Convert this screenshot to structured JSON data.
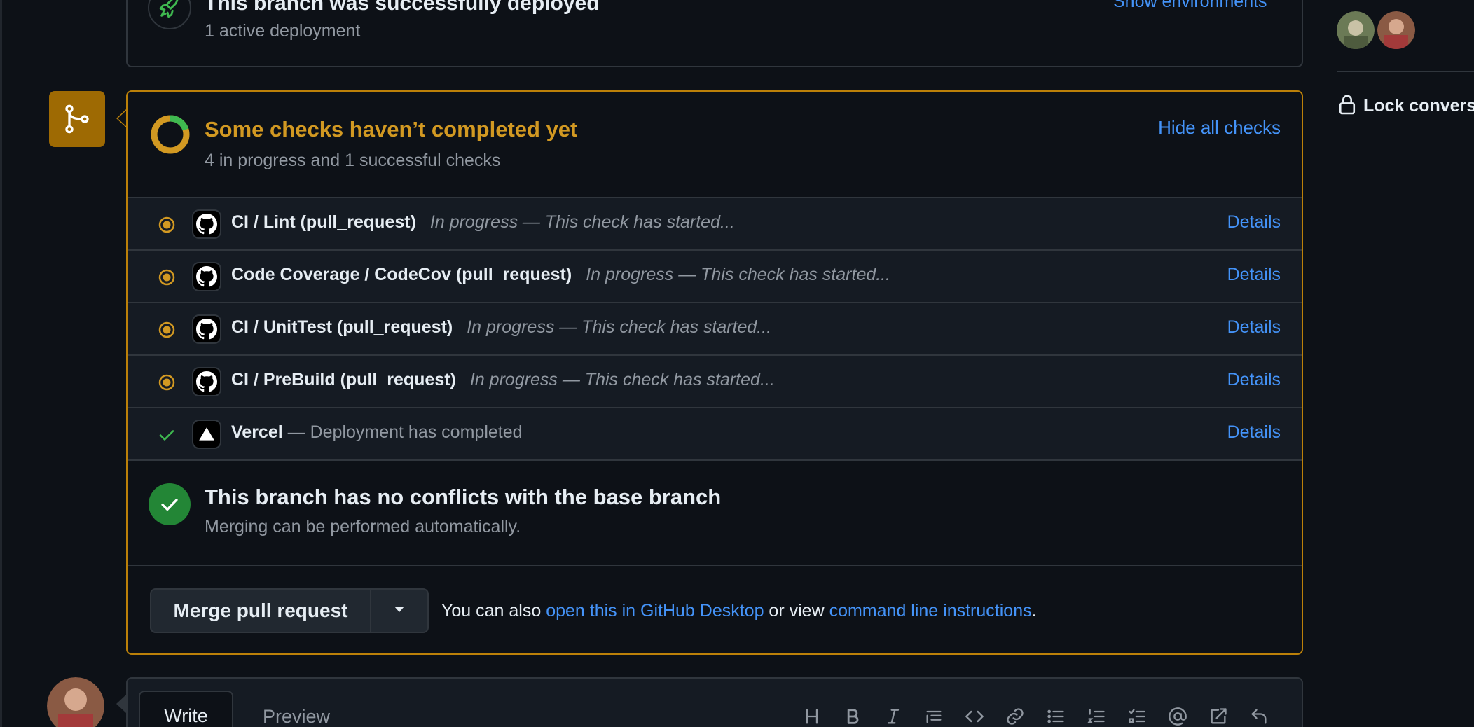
{
  "deployment": {
    "title": "This branch was successfully deployed",
    "subtitle": "1 active deployment",
    "action": "Show environments",
    "icon": "rocket-icon"
  },
  "sidebar": {
    "participants": [
      "avatar-1",
      "avatar-2"
    ],
    "lock_label": "Lock conversa"
  },
  "checks": {
    "title": "Some checks haven’t completed yet",
    "subtitle": "4 in progress and 1 successful checks",
    "toggle": "Hide all checks",
    "progress": {
      "in_progress": 4,
      "successful": 1
    },
    "items": [
      {
        "name": "CI / Lint (pull_request)",
        "description": "In progress — This check has started...",
        "status": "in_progress",
        "app_icon": "github-icon",
        "action": "Details"
      },
      {
        "name": "Code Coverage / CodeCov (pull_request)",
        "description": "In progress — This check has started...",
        "status": "in_progress",
        "app_icon": "github-icon",
        "action": "Details"
      },
      {
        "name": "CI / UnitTest (pull_request)",
        "description": "In progress — This check has started...",
        "status": "in_progress",
        "app_icon": "github-icon",
        "action": "Details"
      },
      {
        "name": "CI / PreBuild (pull_request)",
        "description": "In progress — This check has started...",
        "status": "in_progress",
        "app_icon": "github-icon",
        "action": "Details"
      },
      {
        "name": "Vercel",
        "description": "— Deployment has completed",
        "status": "success",
        "app_icon": "vercel-icon",
        "action": "Details"
      }
    ]
  },
  "conflicts": {
    "title": "This branch has no conflicts with the base branch",
    "subtitle": "Merging can be performed automatically."
  },
  "merge": {
    "button_label": "Merge pull request",
    "note_prefix": "You can also ",
    "link_desktop": "open this in GitHub Desktop",
    "note_middle": " or view ",
    "link_cli": "command line instructions",
    "note_suffix": "."
  },
  "comment": {
    "tab_write": "Write",
    "tab_preview": "Preview",
    "toolbar": [
      "heading-icon",
      "bold-icon",
      "italic-icon",
      "quote-icon",
      "code-icon",
      "link-icon",
      "unordered-list-icon",
      "ordered-list-icon",
      "task-list-icon",
      "mention-icon",
      "cross-reference-icon",
      "undo-icon"
    ]
  },
  "colors": {
    "background": "#0d1117",
    "accent_link": "#4493f8",
    "pending": "#d29922",
    "pending_border": "#bb8009",
    "success": "#238636",
    "success_check": "#3fb950",
    "border": "#30363d"
  }
}
